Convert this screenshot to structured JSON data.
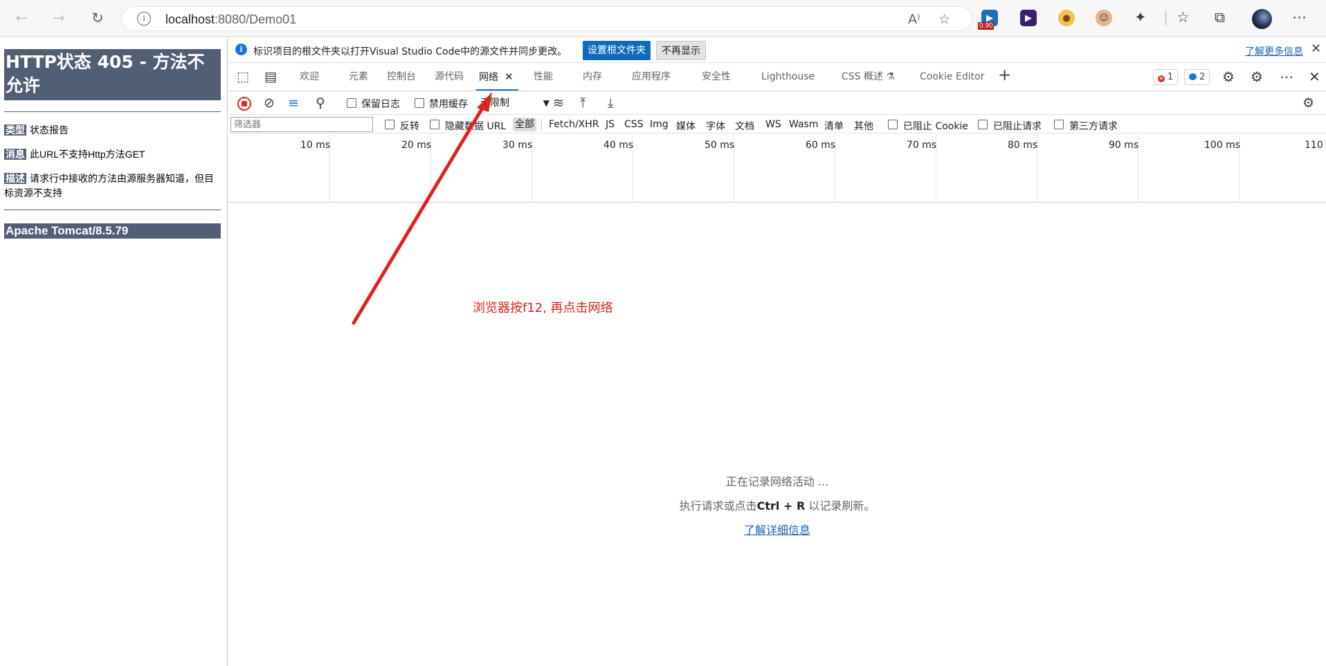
{
  "browser": {
    "address_host": "localhost",
    "address_rest": ":8080/Demo01",
    "ext_badge": "0.90"
  },
  "error_page": {
    "title": "HTTP状态 405 - 方法不允许",
    "rows": [
      {
        "label": "类型",
        "text": "状态报告"
      },
      {
        "label": "消息",
        "text": "此URL不支持Http方法GET"
      },
      {
        "label": "描述",
        "text": "请求行中接收的方法由源服务器知道，但目标资源不支持"
      }
    ],
    "footer": "Apache Tomcat/8.5.79"
  },
  "devtools": {
    "info_bar": {
      "text": "标识项目的根文件夹以打开Visual Studio Code中的源文件并同步更改。",
      "set_root": "设置根文件夹",
      "no_show": "不再显示",
      "learn_more": "了解更多信息"
    },
    "tabs": [
      {
        "label": "欢迎"
      },
      {
        "label": "元素"
      },
      {
        "label": "控制台"
      },
      {
        "label": "源代码"
      },
      {
        "label": "网络",
        "active": true
      },
      {
        "label": "性能"
      },
      {
        "label": "内存"
      },
      {
        "label": "应用程序"
      },
      {
        "label": "安全性"
      },
      {
        "label": "Lighthouse"
      },
      {
        "label": "CSS 概述 ⚗"
      },
      {
        "label": "Cookie Editor"
      }
    ],
    "counters": {
      "errors": "1",
      "messages": "2"
    },
    "network_toolbar": {
      "preserve_log": "保留日志",
      "disable_cache": "禁用缓存",
      "throttle": "无限制"
    },
    "filter_bar": {
      "placeholder": "筛选器",
      "invert": "反转",
      "hide_data_urls": "隐藏数据 URL",
      "types": [
        "全部",
        "Fetch/XHR",
        "JS",
        "CSS",
        "Img",
        "媒体",
        "字体",
        "文档",
        "WS",
        "Wasm",
        "清单",
        "其他"
      ],
      "blocked_cookies": "已阻止 Cookie",
      "blocked_requests": "已阻止请求",
      "third_party": "第三方请求"
    },
    "timeline_ticks": [
      "10 ms",
      "20 ms",
      "30 ms",
      "40 ms",
      "50 ms",
      "60 ms",
      "70 ms",
      "80 ms",
      "90 ms",
      "100 ms",
      "110"
    ],
    "empty_state": {
      "recording": "正在记录网络活动 ...",
      "hint_before": "执行请求或点击",
      "hint_key": "Ctrl + R",
      "hint_after": "以记录刷新。",
      "learn_link": "了解详细信息"
    }
  },
  "annotation": {
    "text": "浏览器按f12, 再点击网络",
    "color": "#e0201f"
  }
}
